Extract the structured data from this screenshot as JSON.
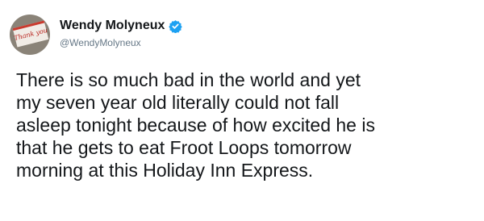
{
  "tweet": {
    "author": {
      "display_name": "Wendy Molyneux",
      "handle": "@WendyMolyneux",
      "verified": true,
      "avatar_card_text": "Thank you"
    },
    "text": "There is so much bad in the world and yet\nmy seven year old literally could not fall\nasleep tonight because of how excited he is\nthat he gets to eat Froot Loops tomorrow\nmorning at this Holiday Inn Express."
  },
  "colors": {
    "text": "#14171a",
    "handle": "#657786",
    "verified": "#1da1f2"
  },
  "icons": {
    "verified": "verified-badge-icon"
  }
}
